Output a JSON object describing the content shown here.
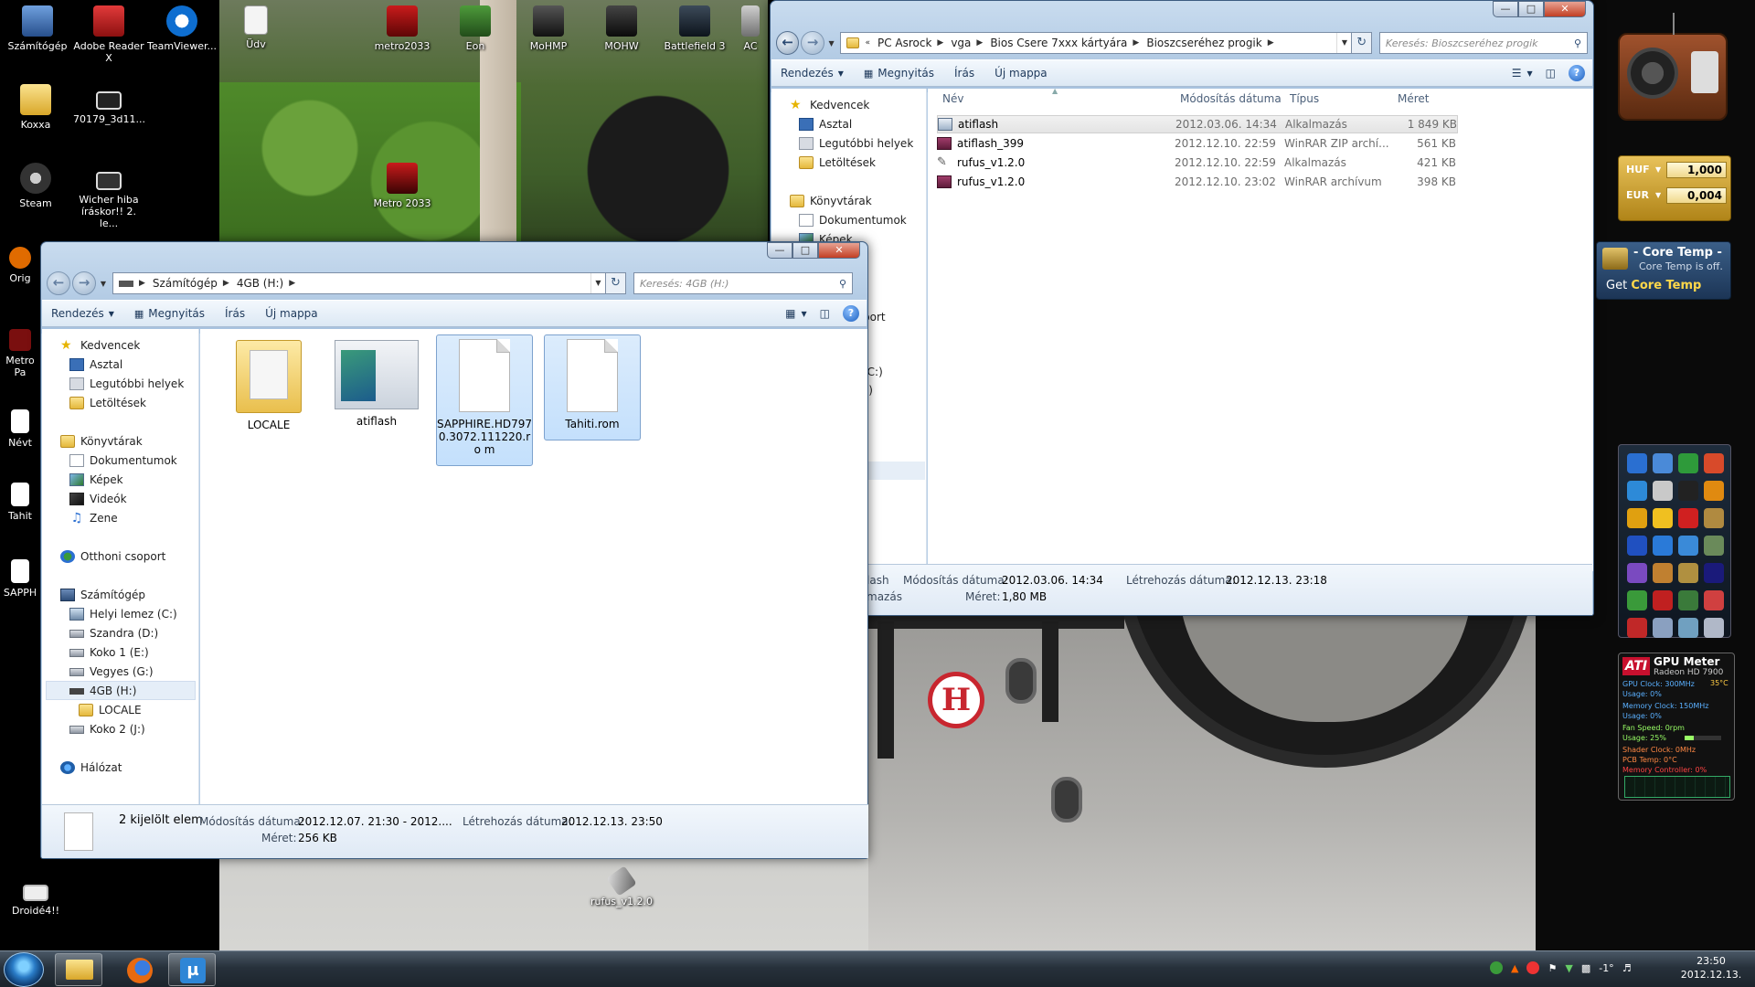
{
  "desktop": {
    "icons_left": [
      {
        "label": "Számítógép",
        "icon": "computer-icon"
      },
      {
        "label": "Adobe Reader X",
        "icon": "adobe-reader-icon"
      },
      {
        "label": "TeamViewer...",
        "icon": "teamviewer-icon"
      },
      {
        "label": "Koxxa",
        "icon": "folder-icon"
      },
      {
        "label": "70179_3d11...",
        "icon": "image-icon"
      },
      {
        "label": "Steam",
        "icon": "steam-icon"
      },
      {
        "label": "Wicher hiba íráskor!! 2. le...",
        "icon": "image-icon"
      },
      {
        "label": "Orig",
        "icon": "origin-icon"
      },
      {
        "label": "Metro Pa",
        "icon": "metro-icon"
      },
      {
        "label": "Névt",
        "icon": "file-icon"
      },
      {
        "label": "Tahit",
        "icon": "file-icon"
      },
      {
        "label": "SAPPH",
        "icon": "file-icon"
      },
      {
        "label": "Droidé4!!",
        "icon": "image-icon"
      }
    ],
    "icons_top": [
      {
        "label": "Üdv",
        "icon": "document-icon"
      },
      {
        "label": "metro2033",
        "icon": "metro-icon"
      },
      {
        "label": "Eon",
        "icon": "eon-icon"
      },
      {
        "label": "MoHMP",
        "icon": "moh-icon"
      },
      {
        "label": "MOHW",
        "icon": "mohw-icon"
      },
      {
        "label": "Battlefield 3",
        "icon": "battlefield-icon"
      },
      {
        "label": "AC",
        "icon": "ac-icon"
      },
      {
        "label": "Metro 2033",
        "icon": "metro-icon"
      }
    ],
    "icon_bottom": {
      "label": "rufus_v1.2.0",
      "icon": "usb-icon"
    }
  },
  "explorer_back": {
    "breadcrumb": [
      "PC Asrock",
      "vga",
      "Bios Csere 7xxx kártyára",
      "Bioszcseréhez progik"
    ],
    "search_placeholder": "Keresés: Bioszcseréhez progik",
    "toolbar": {
      "organize": "Rendezés",
      "open": "Megnyitás",
      "burn": "Írás",
      "new_folder": "Új mappa"
    },
    "nav": {
      "favorites": "Kedvencek",
      "desktop": "Asztal",
      "recent": "Legutóbbi helyek",
      "downloads": "Letöltések",
      "libraries": "Könyvtárak",
      "documents": "Dokumentumok",
      "pictures_partial": "Képek",
      "homegroup_partial": "port",
      "drive_c_partial": "(C:)",
      "drive_d_partial": "s)",
      "drive_e_partial": ")"
    },
    "columns": {
      "name": "Név",
      "date": "Módosítás dátuma",
      "type": "Típus",
      "size": "Méret"
    },
    "files": [
      {
        "name": "atiflash",
        "date": "2012.03.06. 14:34",
        "type": "Alkalmazás",
        "size": "1 849 KB",
        "icon": "app-icon",
        "selected": true
      },
      {
        "name": "atiflash_399",
        "date": "2012.12.10. 22:59",
        "type": "WinRAR ZIP archí...",
        "size": "561 KB",
        "icon": "winrar-icon",
        "selected": false
      },
      {
        "name": "rufus_v1.2.0",
        "date": "2012.12.10. 22:59",
        "type": "Alkalmazás",
        "size": "421 KB",
        "icon": "usb-icon",
        "selected": false
      },
      {
        "name": "rufus_v1.2.0",
        "date": "2012.12.10. 23:02",
        "type": "WinRAR archívum",
        "size": "398 KB",
        "icon": "winrar-icon",
        "selected": false
      }
    ],
    "details": {
      "name_partial": "lash",
      "kind_partial": "mazás",
      "modified_label": "Módosítás dátuma:",
      "modified_value": "2012.03.06. 14:34",
      "created_label": "Létrehozás dátuma:",
      "created_value": "2012.12.13. 23:18",
      "size_label": "Méret:",
      "size_value": "1,80 MB"
    }
  },
  "explorer_front": {
    "breadcrumb": [
      "Számítógép",
      "4GB (H:)"
    ],
    "search_placeholder": "Keresés: 4GB (H:)",
    "toolbar": {
      "organize": "Rendezés",
      "open": "Megnyitás",
      "burn": "Írás",
      "new_folder": "Új mappa"
    },
    "nav": {
      "favorites": "Kedvencek",
      "desktop": "Asztal",
      "recent": "Legutóbbi helyek",
      "downloads": "Letöltések",
      "libraries": "Könyvtárak",
      "documents": "Dokumentumok",
      "pictures": "Képek",
      "videos": "Videók",
      "music": "Zene",
      "homegroup": "Otthoni csoport",
      "computer": "Számítógép",
      "drives": [
        "Helyi lemez (C:)",
        "Szandra (D:)",
        "Koko 1 (E:)",
        "Vegyes (G:)",
        "4GB (H:)",
        "LOCALE",
        "Koko 2 (J:)"
      ],
      "network": "Hálózat"
    },
    "items": [
      {
        "name": "LOCALE",
        "kind": "folder",
        "selected": false
      },
      {
        "name": "atiflash",
        "kind": "app",
        "selected": false
      },
      {
        "name": "SAPPHIRE.HD797 0.3072.111220.ro m",
        "kind": "file",
        "selected": true
      },
      {
        "name": "Tahiti.rom",
        "kind": "file",
        "selected": true
      }
    ],
    "details": {
      "selection": "2 kijelölt elem",
      "modified_label": "Módosítás dátuma:",
      "modified_value": "2012.12.07. 21:30 - 2012....",
      "created_label": "Létrehozás dátuma:",
      "created_value": "2012.12.13. 23:50",
      "size_label": "Méret:",
      "size_value": "256 KB"
    }
  },
  "gadgets": {
    "currency": [
      {
        "code": "HUF",
        "value": "1,000"
      },
      {
        "code": "EUR",
        "value": "0,004"
      }
    ],
    "coretemp": {
      "title": "- Core Temp -",
      "status": "Core Temp is off.",
      "get_prefix": "Get",
      "get_name": "Core Temp"
    },
    "gpu_meter": {
      "title": "GPU Meter",
      "subtitle": "Radeon HD 7900",
      "lines": [
        "GPU Clock: 300MHz",
        "Usage: 0%",
        "Memory Clock: 150MHz",
        "Usage: 0%",
        "Fan Speed: 0rpm",
        "Usage: 25%",
        "Shader Clock: 0MHz",
        "PCB Temp: 0°C",
        "Memory Controller: 0%"
      ],
      "temp": "35°C"
    }
  },
  "taskbar": {
    "tray_temp": "-1°",
    "time": "23:50",
    "date": "2012.12.13."
  },
  "colors": {
    "selection": "#cce8ff",
    "explorer_glass": "#b8cfe6",
    "taskbar": "#27313b",
    "link_blue": "#1e395b"
  }
}
